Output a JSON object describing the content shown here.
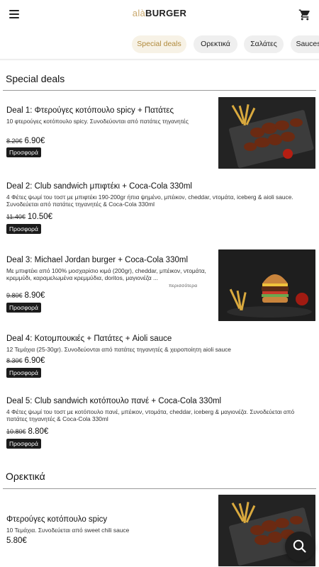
{
  "header": {
    "logo_a": "alà",
    "logo_b": "BURGER",
    "menu_icon": "hamburger-menu-icon",
    "cart_icon": "shopping-cart-icon"
  },
  "tabs": [
    {
      "label": "Special deals",
      "active": true
    },
    {
      "label": "Ορεκτικά",
      "active": false
    },
    {
      "label": "Σαλάτες",
      "active": false
    },
    {
      "label": "Sauces",
      "active": false
    }
  ],
  "sections": [
    {
      "title": "Special deals",
      "items": [
        {
          "title": "Deal 1: Φτερούγες κοτόπουλο spicy + Πατάτες",
          "description": "10 φτερούγες κοτόπουλο spicy. Συνοδεύονται από πατάτες τηγανητές",
          "old_price": "8.20€",
          "price": "6.90€",
          "badge": "Προσφορά"
        },
        {
          "title": "Deal 2: Club sandwich μπιφτέκι + Coca-Cola 330ml",
          "description": "4 Φέτες ψωμί του τοστ με μπιφτέκι 190-200gr ήπια ψημένο, μπέικον, cheddar, ντομάτα, iceberg & aioli sauce. Συνοδεύεται από πατάτες τηγανητές & Coca-Cola 330ml",
          "old_price": "11.40€",
          "price": "10.50€",
          "badge": "Προσφορά"
        },
        {
          "title": "Deal 3: Michael Jordan burger + Coca-Cola 330ml",
          "description": "Με μπιφτέκι από 100% μοσχαρίσιο κιμά (200gr), cheddar, μπέικον, ντομάτα, κρεμμύδι, καραμελωμένα κρεμμύδια, doritos, μαγιονέζα ...",
          "more": "περισσότερα",
          "old_price": "9.80€",
          "price": "8.90€",
          "badge": "Προσφορά"
        },
        {
          "title": "Deal 4: Κοτομπουκιές + Πατάτες + Aioli sauce",
          "description": "12 Τεμάχια (25-30gr). Συνοδεύονται από πατάτες τηγανητές & χειροποίητη aioli sauce",
          "old_price": "8.30€",
          "price": "6.90€",
          "badge": "Προσφορά"
        },
        {
          "title": "Deal 5: Club sandwich κοτόπουλο πανέ + Coca-Cola 330ml",
          "description": "4 Φέτες ψωμί του τοστ με κοτόπουλο πανέ, μπέικον, ντομάτα, cheddar, iceberg & μαγιονέζα. Συνοδεύεται από πατάτες τηγανητές & Coca-Cola 330ml",
          "old_price": "10.80€",
          "price": "8.80€",
          "badge": "Προσφορά"
        }
      ]
    },
    {
      "title": "Ορεκτικά",
      "items": [
        {
          "title": "Φτερούγες κοτόπουλο spicy",
          "description": "10 Τεμάχια. Συνοδεύεται από sweet chili sauce",
          "price": "5.80€"
        }
      ]
    }
  ],
  "fab": {
    "icon": "search-icon"
  },
  "colors": {
    "accent": "#c9a96e",
    "badge_bg": "#1b1b1b",
    "active_tab_bg": "#f7f2e6"
  }
}
